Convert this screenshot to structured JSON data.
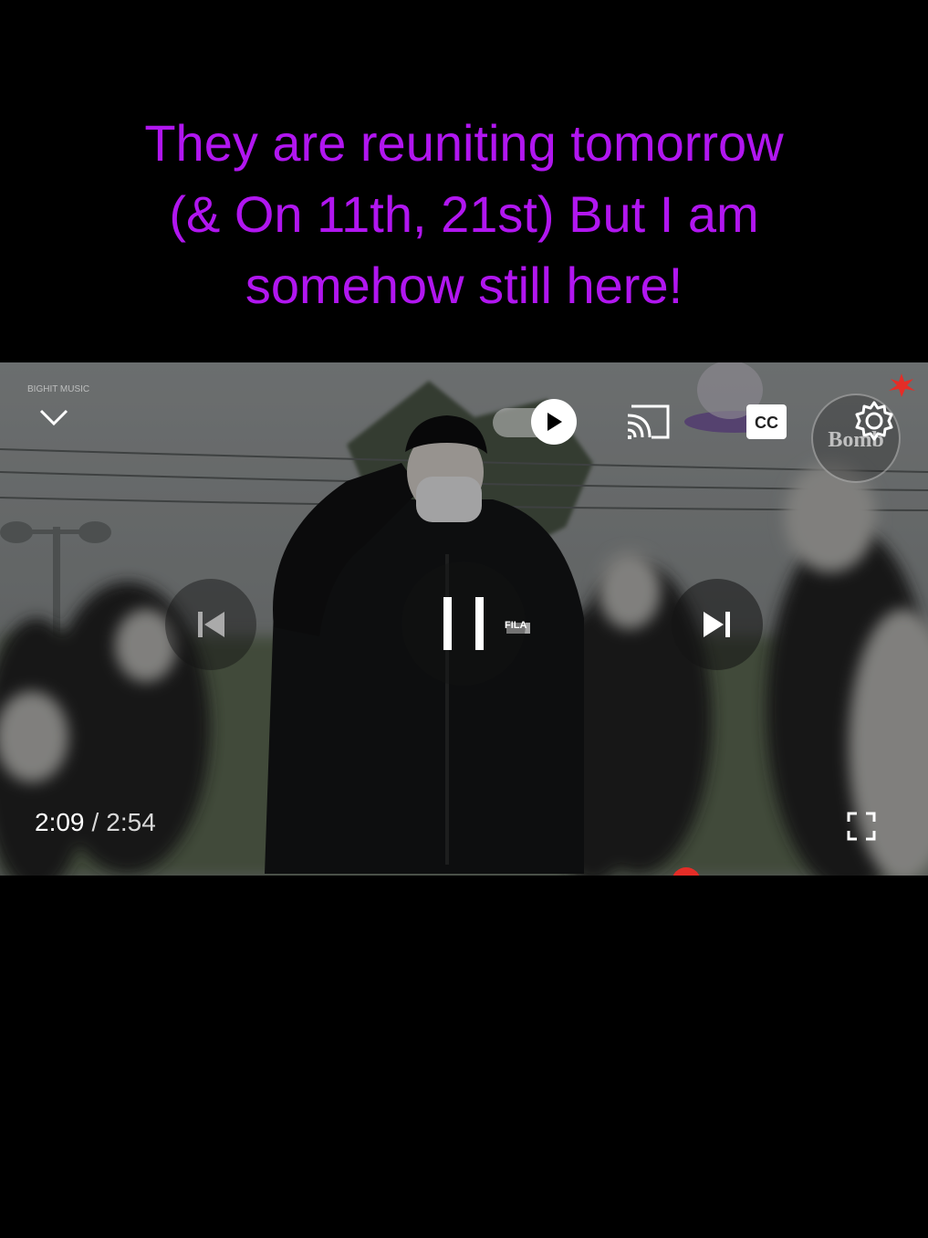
{
  "caption": {
    "line1": "They are reuniting tomorrow",
    "line2": "(& On 11th, 21st) But I am",
    "line3": "somehow still here!"
  },
  "player": {
    "watermark": "BIGHIT MUSIC",
    "bomb_badge_text": "Bomb",
    "fila_logo": "FILA",
    "current_time": "2:09",
    "separator": "/",
    "duration": "2:54",
    "autoplay_state": "on",
    "progress_fraction": 0.741
  },
  "icons": {
    "collapse": "chevron-down-icon",
    "autoplay": "autoplay-toggle-icon",
    "cast": "cast-icon",
    "captions": "cc-icon",
    "settings": "gear-icon",
    "previous": "skip-previous-icon",
    "pause": "pause-icon",
    "next": "skip-next-icon",
    "fullscreen": "fullscreen-icon"
  },
  "colors": {
    "caption_text": "#b116f0",
    "progress_red": "#e52d27"
  }
}
